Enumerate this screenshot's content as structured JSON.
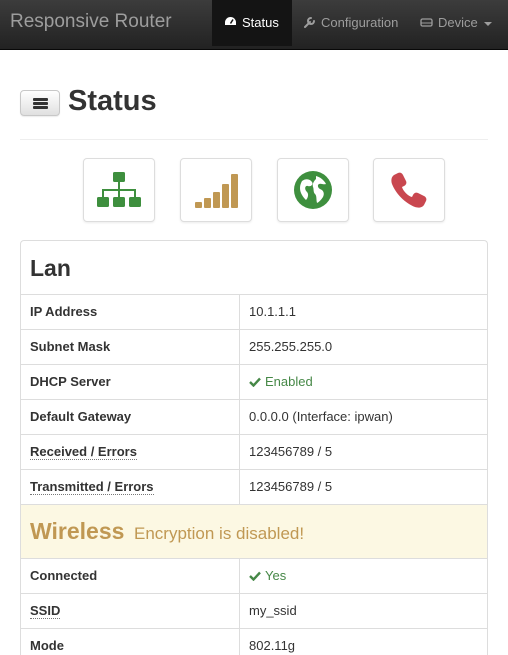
{
  "navbar": {
    "brand": "Responsive Router",
    "items": [
      {
        "label": "Status",
        "icon": "dashboard-icon",
        "active": true
      },
      {
        "label": "Configuration",
        "icon": "wrench-icon",
        "active": false
      },
      {
        "label": "Device",
        "icon": "hdd-icon",
        "active": false,
        "dropdown": true
      }
    ]
  },
  "page": {
    "title": "Status"
  },
  "tiles": [
    {
      "icon": "network-sitemap-icon",
      "color": "#3e8f3e"
    },
    {
      "icon": "signal-bars-icon",
      "color": "#c09853"
    },
    {
      "icon": "globe-icon",
      "color": "#3e8f3e"
    },
    {
      "icon": "phone-icon",
      "color": "#c9474f"
    }
  ],
  "lan": {
    "title": "Lan",
    "rows": [
      {
        "label": "IP Address",
        "value": "10.1.1.1"
      },
      {
        "label": "Subnet Mask",
        "value": "255.255.255.0"
      },
      {
        "label": "DHCP Server",
        "value": "Enabled"
      },
      {
        "label": "Default Gateway",
        "value": "0.0.0.0 (Interface: ipwan)"
      },
      {
        "label": "Received / Errors",
        "value": "123456789 / 5"
      },
      {
        "label": "Transmitted / Errors",
        "value": "123456789 / 5"
      }
    ]
  },
  "wireless": {
    "title": "Wireless",
    "note": "Encryption is disabled!",
    "rows": [
      {
        "label": "Connected",
        "value": "Yes"
      },
      {
        "label": "SSID",
        "value": "my_ssid"
      },
      {
        "label": "Mode",
        "value": "802.11g"
      }
    ]
  },
  "colors": {
    "success": "#468847",
    "warning_text": "#c09853",
    "warning_bg": "#fcf8e3",
    "navbar_bg": "#222222"
  }
}
